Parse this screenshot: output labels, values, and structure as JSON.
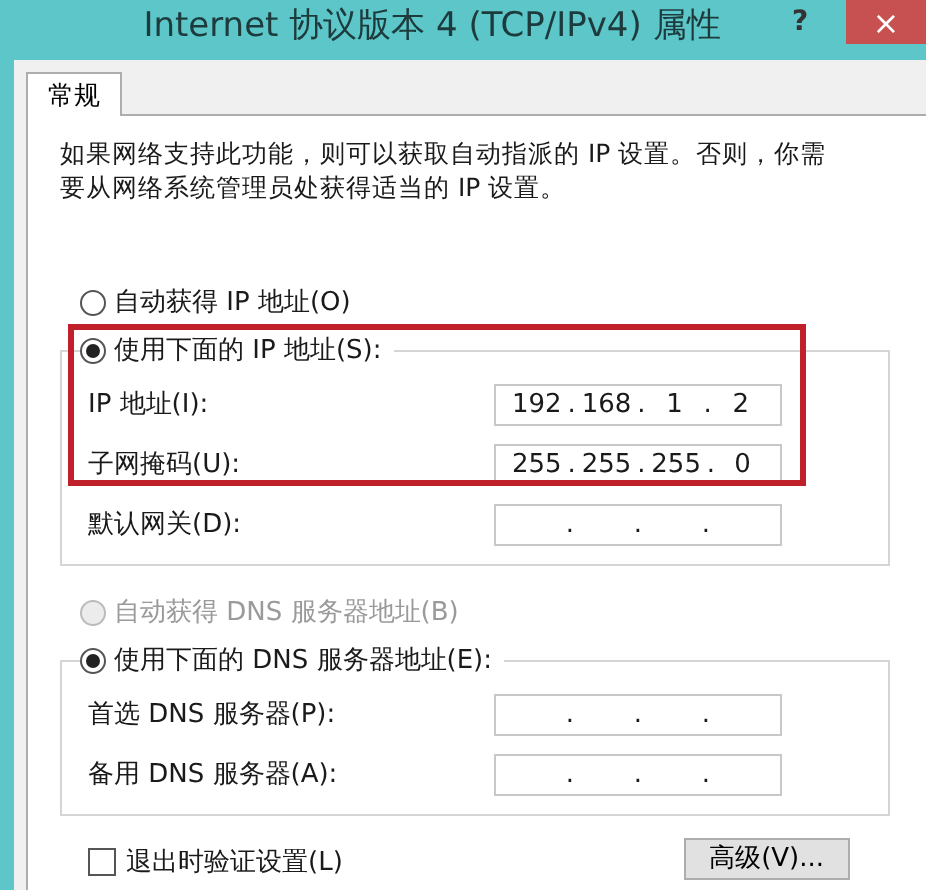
{
  "window": {
    "title": "Internet 协议版本 4 (TCP/IPv4) 属性",
    "help": "?",
    "close": "×"
  },
  "tabs": [
    {
      "label": "常规",
      "selected": true
    }
  ],
  "description": "如果网络支持此功能，则可以获取自动指派的 IP 设置。否则，你需要从网络系统管理员处获得适当的 IP 设置。",
  "ip_group": {
    "auto": {
      "label": "自动获得 IP 地址(O)",
      "selected": false,
      "disabled": false
    },
    "manual": {
      "label": "使用下面的 IP 地址(S):",
      "selected": true,
      "disabled": false
    },
    "fields": [
      {
        "label": "IP 地址(I):",
        "octets": [
          "192",
          "168",
          "1",
          "2"
        ],
        "dots": [
          ".",
          ".",
          "."
        ]
      },
      {
        "label": "子网掩码(U):",
        "octets": [
          "255",
          "255",
          "255",
          "0"
        ],
        "dots": [
          ".",
          ".",
          "."
        ]
      },
      {
        "label": "默认网关(D):",
        "dots": [
          ".",
          ".",
          "."
        ]
      }
    ]
  },
  "dns_group": {
    "auto": {
      "label": "自动获得 DNS 服务器地址(B)",
      "selected": false,
      "disabled": true
    },
    "manual": {
      "label": "使用下面的 DNS 服务器地址(E):",
      "selected": true,
      "disabled": false
    },
    "fields": [
      {
        "label": "首选 DNS 服务器(P):",
        "dots": [
          ".",
          ".",
          "."
        ]
      },
      {
        "label": "备用 DNS 服务器(A):",
        "dots": [
          ".",
          ".",
          "."
        ]
      }
    ]
  },
  "validate": {
    "label": "退出时验证设置(L)",
    "checked": false
  },
  "advanced_button": "高级(V)..."
}
